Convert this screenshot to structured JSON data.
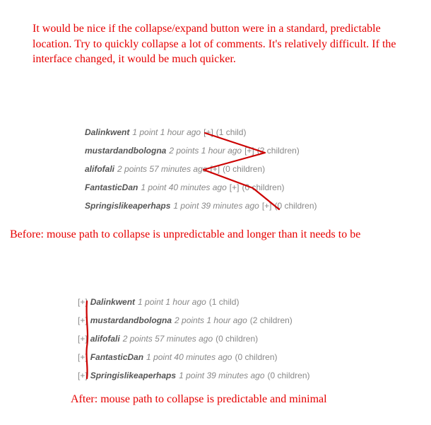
{
  "intro_text": "It would be nice if the collapse/expand button were in a standard, predictable location.  Try to quickly collapse a lot of comments.  It's relatively difficult.  If the interface changed, it would be much quicker.",
  "caption_before": "Before: mouse path to collapse is unpredictable and longer than it needs to be",
  "caption_after": "After: mouse path to collapse is predictable and minimal",
  "toggle_glyph": "[+]",
  "comments": [
    {
      "user": "Dalinkwent",
      "meta": "1 point 1 hour ago",
      "children": "(1 child)"
    },
    {
      "user": "mustardandbologna",
      "meta": "2 points 1 hour ago",
      "children": "(2 children)"
    },
    {
      "user": "alifofali",
      "meta": "2 points 57 minutes ago",
      "children": "(0 children)"
    },
    {
      "user": "FantasticDan",
      "meta": "1 point 40 minutes ago",
      "children": "(0 children)"
    },
    {
      "user": "Springislikeaperhaps",
      "meta": "1 point 39 minutes ago",
      "children": "(0 children)"
    }
  ]
}
